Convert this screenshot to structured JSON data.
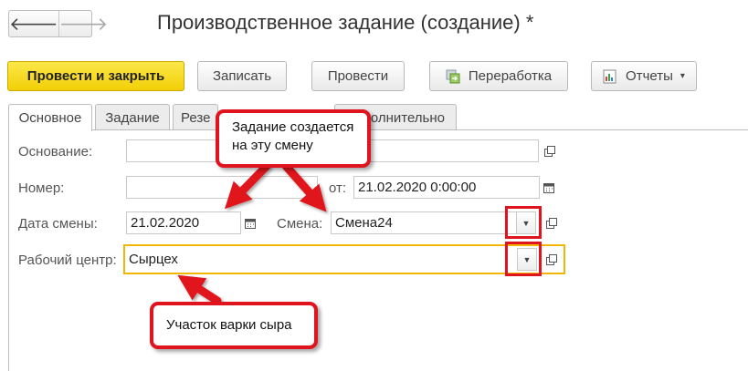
{
  "window": {
    "title": "Производственное задание (создание) *"
  },
  "nav": {
    "back": "🡐",
    "forward": "🡒"
  },
  "toolbar": {
    "post_close": "Провести и закрыть",
    "save": "Записать",
    "post": "Провести",
    "rework": "Переработка",
    "reports": "Отчеты",
    "reports_caret": "▾"
  },
  "tabs": [
    "Основное",
    "Задание",
    "Резе",
    "олнительно"
  ],
  "form": {
    "basis_label": "Основание:",
    "basis_value": "",
    "number_label": "Номер:",
    "number_value": "",
    "from_label": "от:",
    "from_value": "21.02.2020  0:00:00",
    "shift_date_label": "Дата смены:",
    "shift_date_value": "21.02.2020",
    "shift_label": "Смена:",
    "shift_value": "Смена24",
    "work_center_label": "Рабочий центр:",
    "work_center_value": "Сырцех"
  },
  "callouts": {
    "shift_note": "Задание создается на эту смену",
    "work_center_note": "Участок варки сыра"
  },
  "colors": {
    "accent": "#f2cf06",
    "highlight": "#e0141e"
  }
}
